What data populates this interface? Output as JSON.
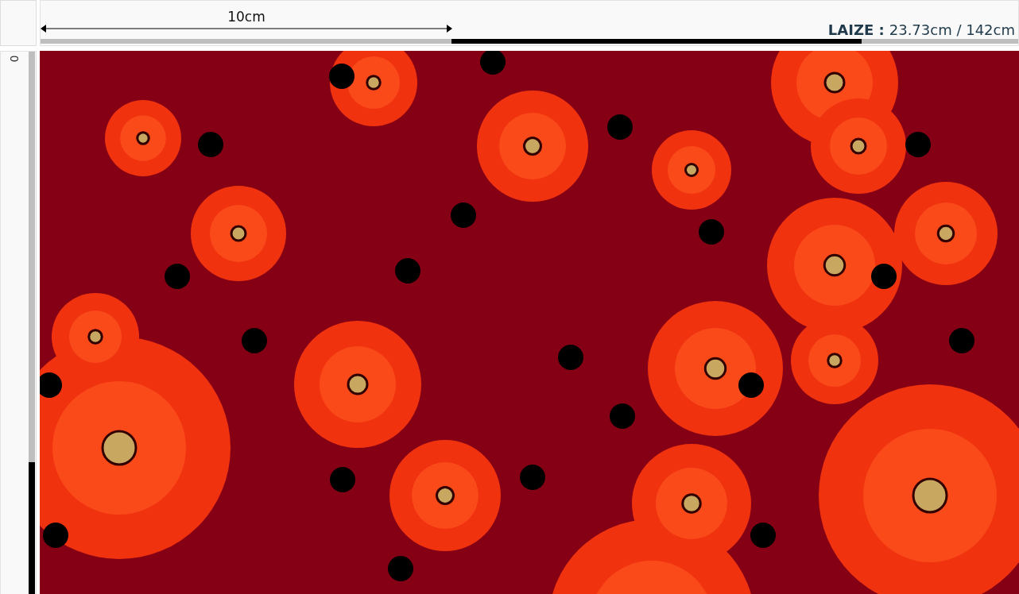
{
  "top_ruler": {
    "measure_label": "10cm",
    "width_label": "LAIZE :",
    "width_value": "23.73cm / 142cm"
  },
  "left_ruler": {
    "label": "0"
  }
}
